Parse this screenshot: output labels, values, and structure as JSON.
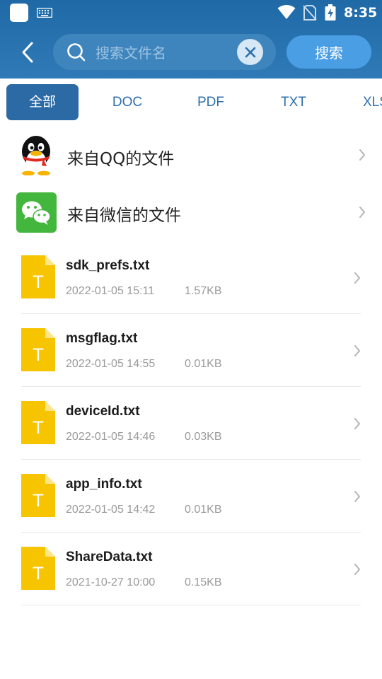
{
  "status_bar": {
    "time": "8:35",
    "icons": [
      "app-square-icon",
      "keyboard-icon",
      "wifi-icon",
      "no-sim-icon",
      "battery-charging-icon"
    ]
  },
  "header": {
    "back_icon": "chevron-left-icon",
    "search": {
      "placeholder": "搜索文件名",
      "value": ""
    },
    "search_button": "搜索",
    "colors": {
      "bar": "#2a74b0",
      "search_button": "#4a9ee4",
      "accent": "#2b6aa4"
    }
  },
  "tabs": [
    {
      "label": "全部",
      "active": true
    },
    {
      "label": "DOC",
      "active": false
    },
    {
      "label": "PDF",
      "active": false
    },
    {
      "label": "TXT",
      "active": false
    },
    {
      "label": "XLS",
      "active": false
    }
  ],
  "sources": [
    {
      "label": "来自QQ的文件",
      "icon": "qq-penguin-icon"
    },
    {
      "label": "来自微信的文件",
      "icon": "wechat-icon"
    }
  ],
  "files": [
    {
      "name": "sdk_prefs.txt",
      "date": "2022-01-05 15:11",
      "size": "1.57KB",
      "icon_letter": "T"
    },
    {
      "name": "msgflag.txt",
      "date": "2022-01-05 14:55",
      "size": "0.01KB",
      "icon_letter": "T"
    },
    {
      "name": "deviceId.txt",
      "date": "2022-01-05 14:46",
      "size": "0.03KB",
      "icon_letter": "T"
    },
    {
      "name": "app_info.txt",
      "date": "2022-01-05 14:42",
      "size": "0.01KB",
      "icon_letter": "T"
    },
    {
      "name": "ShareData.txt",
      "date": "2021-10-27 10:00",
      "size": "0.15KB",
      "icon_letter": "T"
    }
  ]
}
